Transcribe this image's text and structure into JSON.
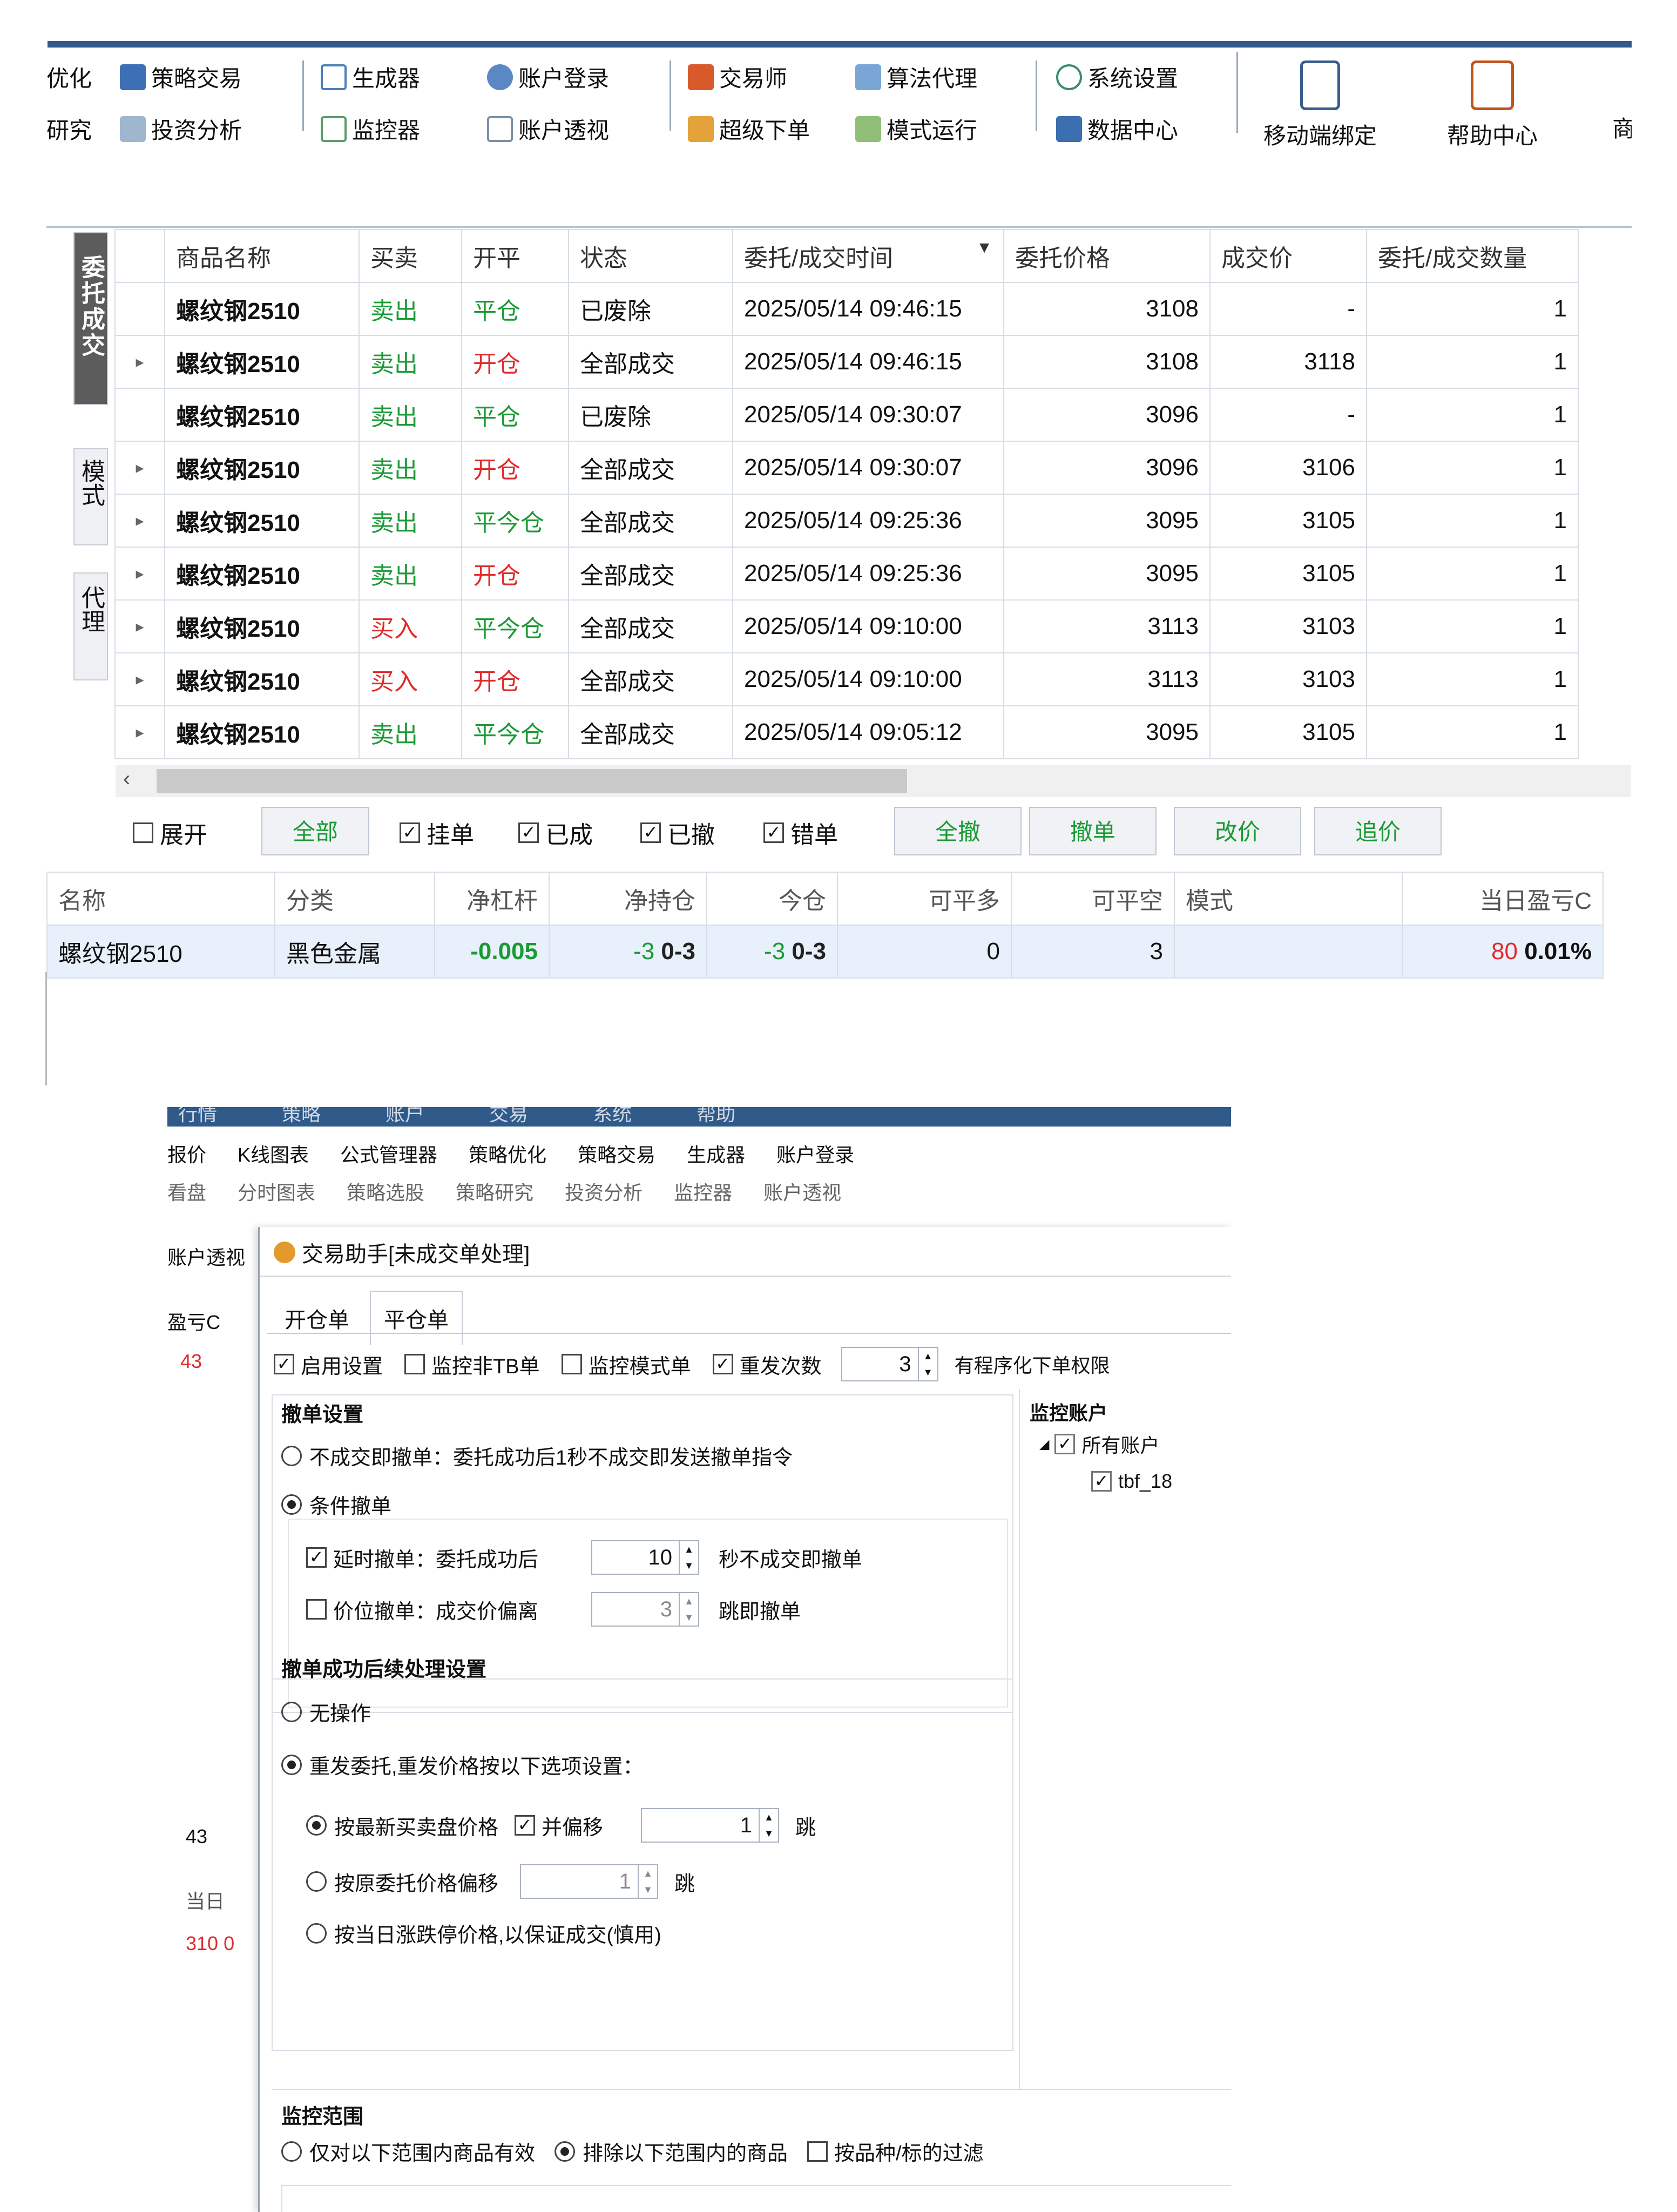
{
  "top": {
    "ribbon": {
      "row1": [
        "优化",
        "策略交易",
        "生成器",
        "账户登录",
        "交易师",
        "算法代理",
        "系统设置"
      ],
      "row2": [
        "研究",
        "投资分析",
        "监控器",
        "账户透视",
        "超级下单",
        "模式运行",
        "数据中心"
      ],
      "big_buttons": [
        "移动端绑定",
        "帮助中心"
      ],
      "cut_right": "商"
    },
    "side_tabs": [
      "委托成交",
      "模式",
      "代理"
    ],
    "table": {
      "columns": [
        "商品名称",
        "买卖",
        "开平",
        "状态",
        "委托/成交时间",
        "委托价格",
        "成交价",
        "委托/成交数量"
      ],
      "rows": [
        {
          "expander": "",
          "name": "螺纹钢2510",
          "side": "卖出",
          "oc": "平仓",
          "status": "已废除",
          "time": "2025/05/14 09:46:15",
          "price": "3108",
          "fill": "-",
          "qty": "1"
        },
        {
          "expander": "▸",
          "name": "螺纹钢2510",
          "side": "卖出",
          "oc": "开仓",
          "status": "全部成交",
          "time": "2025/05/14 09:46:15",
          "price": "3108",
          "fill": "3118",
          "qty": "1"
        },
        {
          "expander": "",
          "name": "螺纹钢2510",
          "side": "卖出",
          "oc": "平仓",
          "status": "已废除",
          "time": "2025/05/14 09:30:07",
          "price": "3096",
          "fill": "-",
          "qty": "1"
        },
        {
          "expander": "▸",
          "name": "螺纹钢2510",
          "side": "卖出",
          "oc": "开仓",
          "status": "全部成交",
          "time": "2025/05/14 09:30:07",
          "price": "3096",
          "fill": "3106",
          "qty": "1"
        },
        {
          "expander": "▸",
          "name": "螺纹钢2510",
          "side": "卖出",
          "oc": "平今仓",
          "status": "全部成交",
          "time": "2025/05/14 09:25:36",
          "price": "3095",
          "fill": "3105",
          "qty": "1"
        },
        {
          "expander": "▸",
          "name": "螺纹钢2510",
          "side": "卖出",
          "oc": "开仓",
          "status": "全部成交",
          "time": "2025/05/14 09:25:36",
          "price": "3095",
          "fill": "3105",
          "qty": "1"
        },
        {
          "expander": "▸",
          "name": "螺纹钢2510",
          "side": "买入",
          "oc": "平今仓",
          "status": "全部成交",
          "time": "2025/05/14 09:10:00",
          "price": "3113",
          "fill": "3103",
          "qty": "1"
        },
        {
          "expander": "▸",
          "name": "螺纹钢2510",
          "side": "买入",
          "oc": "开仓",
          "status": "全部成交",
          "time": "2025/05/14 09:10:00",
          "price": "3113",
          "fill": "3103",
          "qty": "1"
        },
        {
          "expander": "▸",
          "name": "螺纹钢2510",
          "side": "卖出",
          "oc": "平今仓",
          "status": "全部成交",
          "time": "2025/05/14 09:05:12",
          "price": "3095",
          "fill": "3105",
          "qty": "1"
        }
      ]
    },
    "filters": {
      "expand": "展开",
      "all": "全部",
      "pending": "挂单",
      "filled": "已成",
      "cancelled": "已撤",
      "error": "错单"
    },
    "actions": [
      "全撤",
      "撤单",
      "改价",
      "追价"
    ],
    "position": {
      "columns": [
        "名称",
        "分类",
        "净杠杆",
        "净持仓",
        "今仓",
        "可平多",
        "可平空",
        "模式",
        "当日盈亏C"
      ],
      "row": {
        "name": "螺纹钢2510",
        "cat": "黑色金属",
        "lev": "-0.005",
        "net": "-3",
        "net_sub": "0-3",
        "today": "-3",
        "today_sub": "0-3",
        "long": "0",
        "short": "3",
        "mode": "",
        "pnl": "80",
        "pnl_pct": "0.01%"
      }
    }
  },
  "bottom": {
    "menu": [
      "行情",
      "策略",
      "账户",
      "交易",
      "系统",
      "帮助"
    ],
    "ribbon_row1": [
      "报价",
      "K线图表",
      "公式管理器",
      "策略优化",
      "策略交易",
      "生成器",
      "账户登录"
    ],
    "ribbon_row2": [
      "看盘",
      "分时图表",
      "策略选股",
      "策略研究",
      "投资分析",
      "监控器",
      "账户透视"
    ],
    "bg_left": {
      "tab": "账户透视",
      "pnl_head": "盈亏C",
      "pnl1": "43",
      "pnl2": "43",
      "head2": "当日",
      "pnl3": "310",
      "pnl3_tail": "0"
    },
    "dialog": {
      "title": "交易助手[未成交单处理]",
      "tabs": [
        "开仓单",
        "平仓单"
      ],
      "opts": {
        "enable": "启用设置",
        "mon_tb": "监控非TB单",
        "mon_mode": "监控模式单",
        "resend": "重发次数",
        "resend_val": "3",
        "perm": "有程序化下单权限"
      },
      "cancel_group": "撤单设置",
      "r_immediate": "不成交即撤单：委托成功后1秒不成交即发送撤单指令",
      "r_conditional": "条件撤单",
      "delay_label": "延时撤单：委托成功后",
      "delay_val": "10",
      "delay_suffix": "秒不成交即撤单",
      "price_label": "价位撤单：成交价偏离",
      "price_val": "3",
      "price_suffix": "跳即撤单",
      "after_group": "撤单成功后续处理设置",
      "r_none": "无操作",
      "r_resend": "重发委托,重发价格按以下选项设置：",
      "r_latest": "按最新买卖盘价格",
      "offset_label": "并偏移",
      "offset_val": "1",
      "tick": "跳",
      "r_orig": "按原委托价格偏移",
      "orig_val": "1",
      "tick2": "跳",
      "r_limit": "按当日涨跌停价格,以保证成交(慎用)",
      "monitor_acct": "监控账户",
      "all_accts": "所有账户",
      "acct1": "tbf_18",
      "scope_group": "监控范围",
      "r_only": "仅对以下范围内商品有效",
      "r_exclude": "排除以下范围内的商品",
      "by_variety": "按品种/标的过滤"
    }
  },
  "colors": {
    "red": "#e02a2a",
    "green": "#1a9a34",
    "accent": "#2f5a8a"
  }
}
